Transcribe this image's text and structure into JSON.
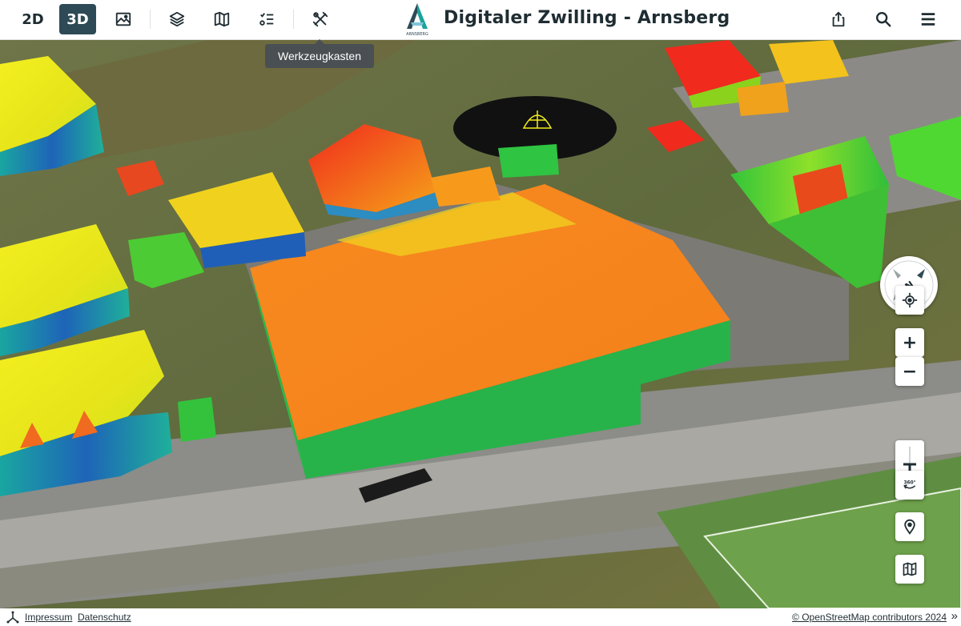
{
  "app": {
    "title": "Digitaler Zwilling - Arnsberg",
    "logo_text": "ARNSBERG"
  },
  "toolbar": {
    "view_2d_label": "2D",
    "view_3d_label": "3D",
    "active_view": "3D",
    "icons": [
      "image-icon",
      "layers-icon",
      "map-book-icon",
      "legend-list-icon",
      "toolbox-icon",
      "share-icon",
      "search-icon",
      "menu-icon"
    ]
  },
  "tooltip": {
    "text": "Werkzeugkasten"
  },
  "controls": {
    "compass_letter": "N",
    "zoom_in": "+",
    "zoom_out": "−",
    "rotate_label": "360°"
  },
  "footer": {
    "impressum": "Impressum",
    "datenschutz": "Datenschutz",
    "attribution": "© OpenStreetMap contributors 2024",
    "expand_glyph": "»"
  },
  "colors": {
    "accent": "#2e4a56",
    "brand_teal": "#1aa39a"
  }
}
